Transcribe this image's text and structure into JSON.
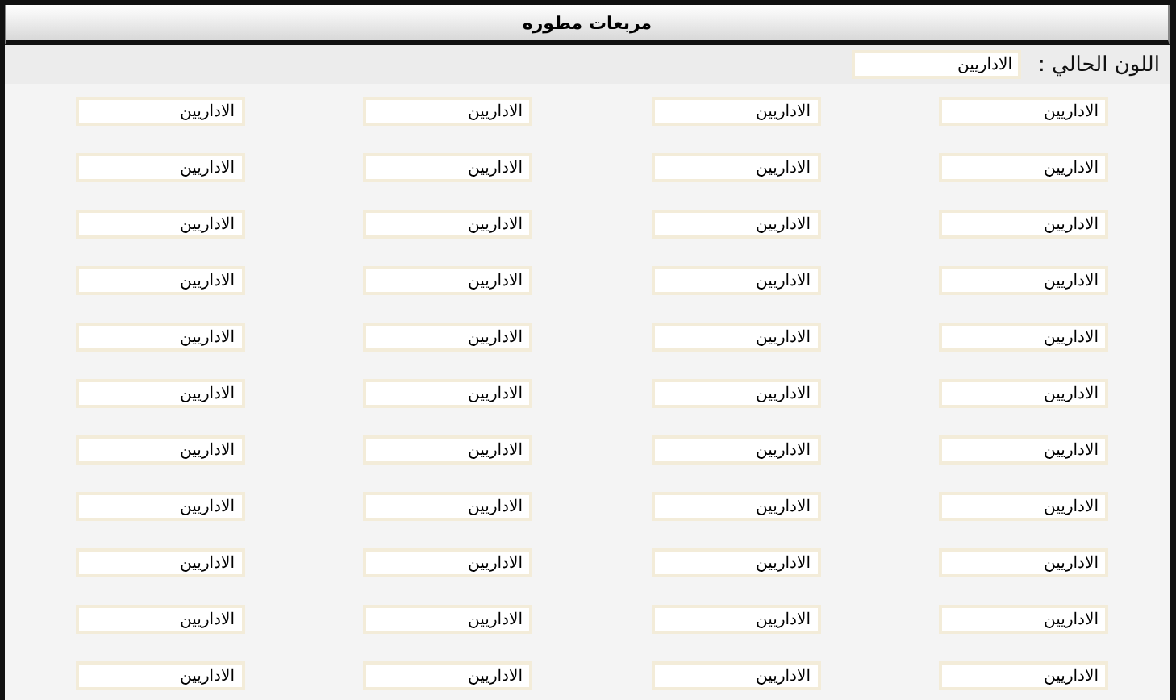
{
  "window": {
    "title": "مربعات مطوره"
  },
  "current_color": {
    "label": "اللون الحالي :",
    "value": "الاداريين"
  },
  "grid": {
    "rows": [
      [
        "الاداريين",
        "الاداريين",
        "الاداريين",
        "الاداريين"
      ],
      [
        "الاداريين",
        "الاداريين",
        "الاداريين",
        "الاداريين"
      ],
      [
        "الاداريين",
        "الاداريين",
        "الاداريين",
        "الاداريين"
      ],
      [
        "الاداريين",
        "الاداريين",
        "الاداريين",
        "الاداريين"
      ],
      [
        "الاداريين",
        "الاداريين",
        "الاداريين",
        "الاداريين"
      ],
      [
        "الاداريين",
        "الاداريين",
        "الاداريين",
        "الاداريين"
      ],
      [
        "الاداريين",
        "الاداريين",
        "الاداريين",
        "الاداريين"
      ],
      [
        "الاداريين",
        "الاداريين",
        "الاداريين",
        "الاداريين"
      ],
      [
        "الاداريين",
        "الاداريين",
        "الاداريين",
        "الاداريين"
      ],
      [
        "الاداريين",
        "الاداريين",
        "الاداريين",
        "الاداريين"
      ],
      [
        "الاداريين",
        "الاداريين",
        "الاداريين",
        "الاداريين"
      ]
    ]
  }
}
